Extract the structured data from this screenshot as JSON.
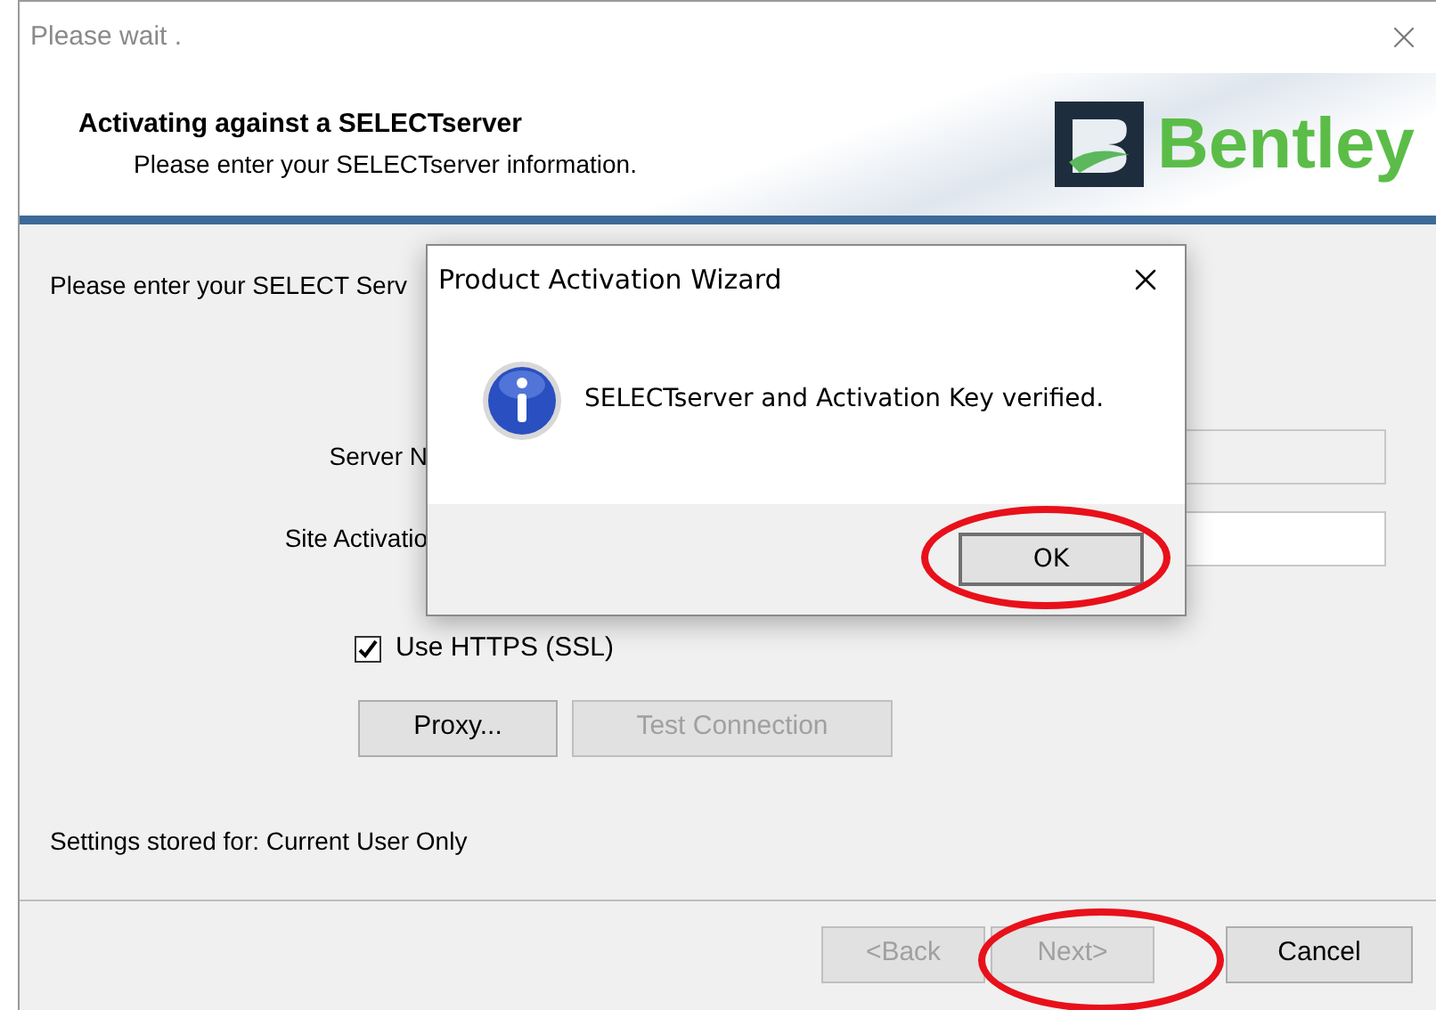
{
  "window": {
    "title": "Please wait ."
  },
  "header": {
    "title": "Activating against a SELECTserver",
    "subtitle": "Please enter your SELECTserver information.",
    "logo_text": "Bentley"
  },
  "form": {
    "intro": "Please enter your SELECT Serv",
    "fields": [
      {
        "label": "Server N"
      },
      {
        "label": "Site Activatio"
      }
    ],
    "https": {
      "label": "Use HTTPS (SSL)",
      "checked": true
    },
    "buttons": [
      {
        "label": "Proxy...",
        "disabled": false
      },
      {
        "label": "Test Connection",
        "disabled": true
      }
    ],
    "settings": "Settings stored for: Current User Only"
  },
  "footer_buttons": [
    {
      "label": "<Back",
      "disabled": true,
      "highlighted": false
    },
    {
      "label": "Next>",
      "disabled": true,
      "highlighted": true
    },
    {
      "label": "Cancel",
      "disabled": false,
      "highlighted": false
    }
  ],
  "dialog": {
    "title": "Product Activation Wizard",
    "message": "SELECTserver and Activation Key verified.",
    "button": {
      "label": "OK",
      "highlighted": true
    }
  }
}
